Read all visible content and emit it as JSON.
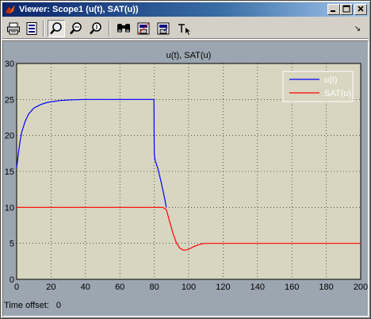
{
  "window": {
    "title": "Viewer: Scope1 (u(t), SAT(u))",
    "title_buttons": [
      "minimize",
      "maximize",
      "close"
    ]
  },
  "toolbar": {
    "items": [
      "print-icon",
      "parameters-icon",
      "zoom-icon",
      "zoom-x-icon",
      "zoom-y-icon",
      "autoscale-icon",
      "save-axes-icon",
      "restore-axes-icon",
      "floating-scope-icon"
    ],
    "overflow": "↘"
  },
  "status": {
    "time_offset_label": "Time offset:",
    "time_offset_value": "0"
  },
  "colors": {
    "plot_bg": "#d8d6c0",
    "frame_bg": "#9ba6b0",
    "series_u": "#0000ff",
    "series_sat": "#ff0000",
    "legend_bg": "#d8d6c0"
  },
  "chart_data": {
    "type": "line",
    "title": "u(t), SAT(u)",
    "xlabel": "",
    "ylabel": "",
    "xlim": [
      0,
      200
    ],
    "ylim": [
      0,
      30
    ],
    "xticks": [
      0,
      20,
      40,
      60,
      80,
      100,
      120,
      140,
      160,
      180,
      200
    ],
    "yticks": [
      0,
      5,
      10,
      15,
      20,
      25,
      30
    ],
    "grid": true,
    "legend_position": "top-right",
    "series": [
      {
        "name": "u(t)",
        "color": "#0000ff",
        "x": [
          0,
          1,
          2,
          3,
          5,
          7,
          10,
          14,
          18,
          25,
          32,
          40,
          50,
          60,
          70,
          79,
          79.8,
          80,
          80.5,
          82,
          84,
          86,
          87
        ],
        "y": [
          15.5,
          17.5,
          19.2,
          20.5,
          22.0,
          23.0,
          23.8,
          24.3,
          24.6,
          24.85,
          24.95,
          25,
          25,
          25,
          25,
          25,
          25,
          17.5,
          16.5,
          15.5,
          13.5,
          11.3,
          10.0
        ]
      },
      {
        "name": "SAT(u)",
        "color": "#ff0000",
        "x": [
          0,
          10,
          20,
          30,
          40,
          50,
          60,
          70,
          80,
          85,
          87,
          89,
          91,
          93,
          95,
          97,
          99,
          101,
          103,
          105,
          108,
          110,
          115,
          120,
          140,
          160,
          180,
          200
        ],
        "y": [
          10,
          10,
          10,
          10,
          10,
          10,
          10,
          10,
          10,
          10,
          9.7,
          8.0,
          6.3,
          5.0,
          4.3,
          4.05,
          4.1,
          4.3,
          4.55,
          4.75,
          4.95,
          5.0,
          5.0,
          5.0,
          5.0,
          5.0,
          5.0,
          5.0
        ]
      }
    ]
  }
}
